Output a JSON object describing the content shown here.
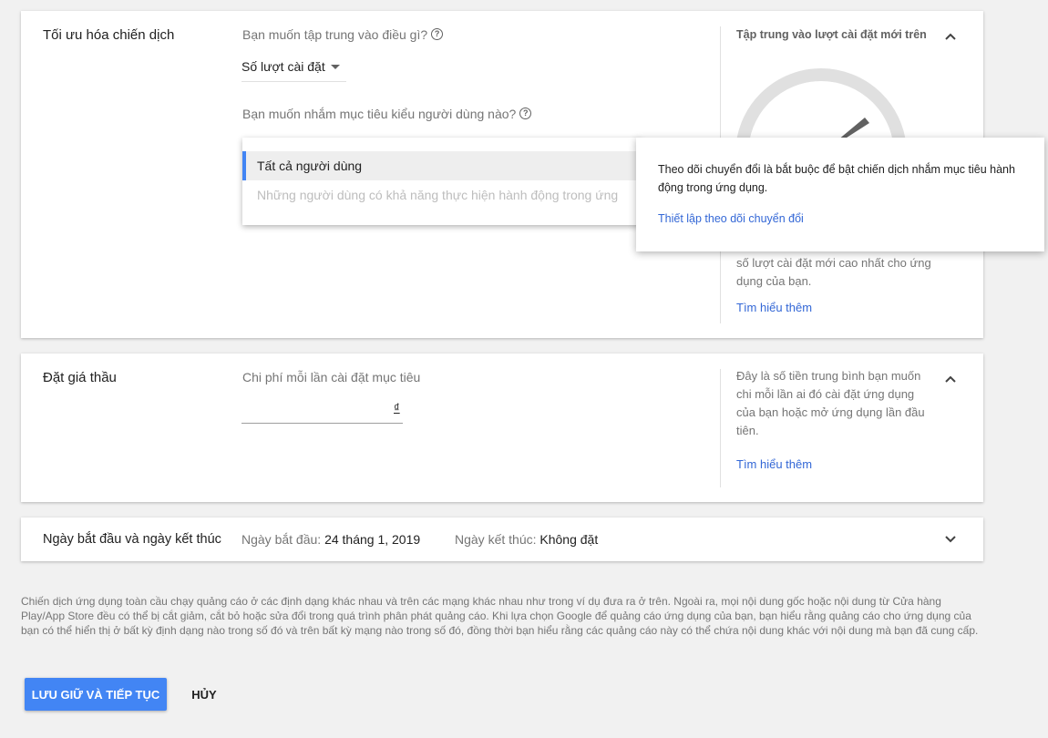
{
  "optimization": {
    "title": "Tối ưu hóa chiến dịch",
    "focus_question": "Bạn muốn tập trung vào điều gì?",
    "focus_selected": "Số lượt cài đặt",
    "target_question": "Bạn muốn nhắm mục tiêu kiểu người dùng nào?",
    "dropdown_options": [
      "Tất cả người dùng",
      "Những người dùng có khả năng thực hiện hành động trong ứng"
    ],
    "side_title": "Tập trung vào lượt cài đặt mới trên",
    "side_text": "số lượt cài đặt mới cao nhất cho ứng dụng của bạn.",
    "learn_more": "Tìm hiểu thêm"
  },
  "tooltip": {
    "text": "Theo dõi chuyển đổi là bắt buộc để bật chiến dịch nhắm mục tiêu hành động trong ứng dụng.",
    "link": "Thiết lập theo dõi chuyển đổi"
  },
  "bidding": {
    "title": "Đặt giá thầu",
    "field_label": "Chi phí mỗi lần cài đặt mục tiêu",
    "currency": "₫",
    "side_text": "Đây là số tiền trung bình bạn muốn chi mỗi lần ai đó cài đặt ứng dụng của bạn hoặc mở ứng dụng lần đầu tiên.",
    "learn_more": "Tìm hiểu thêm"
  },
  "dates": {
    "title": "Ngày bắt đầu và ngày kết thúc",
    "start_label": "Ngày bắt đầu:",
    "start_value": "24 tháng 1, 2019",
    "end_label": "Ngày kết thúc:",
    "end_value": "Không đặt"
  },
  "footer": {
    "disclaimer": "Chiến dịch ứng dụng toàn cầu chạy quảng cáo ở các định dạng khác nhau và trên các mạng khác nhau như trong ví dụ đưa ra ở trên. Ngoài ra, mọi nội dung gốc hoặc nội dung từ Cửa hàng Play/App Store đều có thể bị cắt giảm, cắt bỏ hoặc sửa đổi trong quá trình phân phát quảng cáo. Khi lựa chọn Google để quảng cáo ứng dụng của bạn, bạn hiểu rằng quảng cáo cho ứng dụng của bạn có thể hiển thị ở bất kỳ định dạng nào trong số đó và trên bất kỳ mạng nào trong số đó, đồng thời bạn hiểu rằng các quảng cáo này có thể chứa nội dung khác với nội dung mà bạn đã cung cấp.",
    "save_label": "LƯU GIỮ VÀ TIẾP TỤC",
    "cancel_label": "HỦY"
  },
  "colors": {
    "accent": "#4285f4",
    "link": "#3367d6",
    "background": "#f1f1f1"
  },
  "icons": [
    "help-icon",
    "chevron-up-icon",
    "chevron-down-icon",
    "dropdown-caret-icon",
    "gauge-icon"
  ]
}
